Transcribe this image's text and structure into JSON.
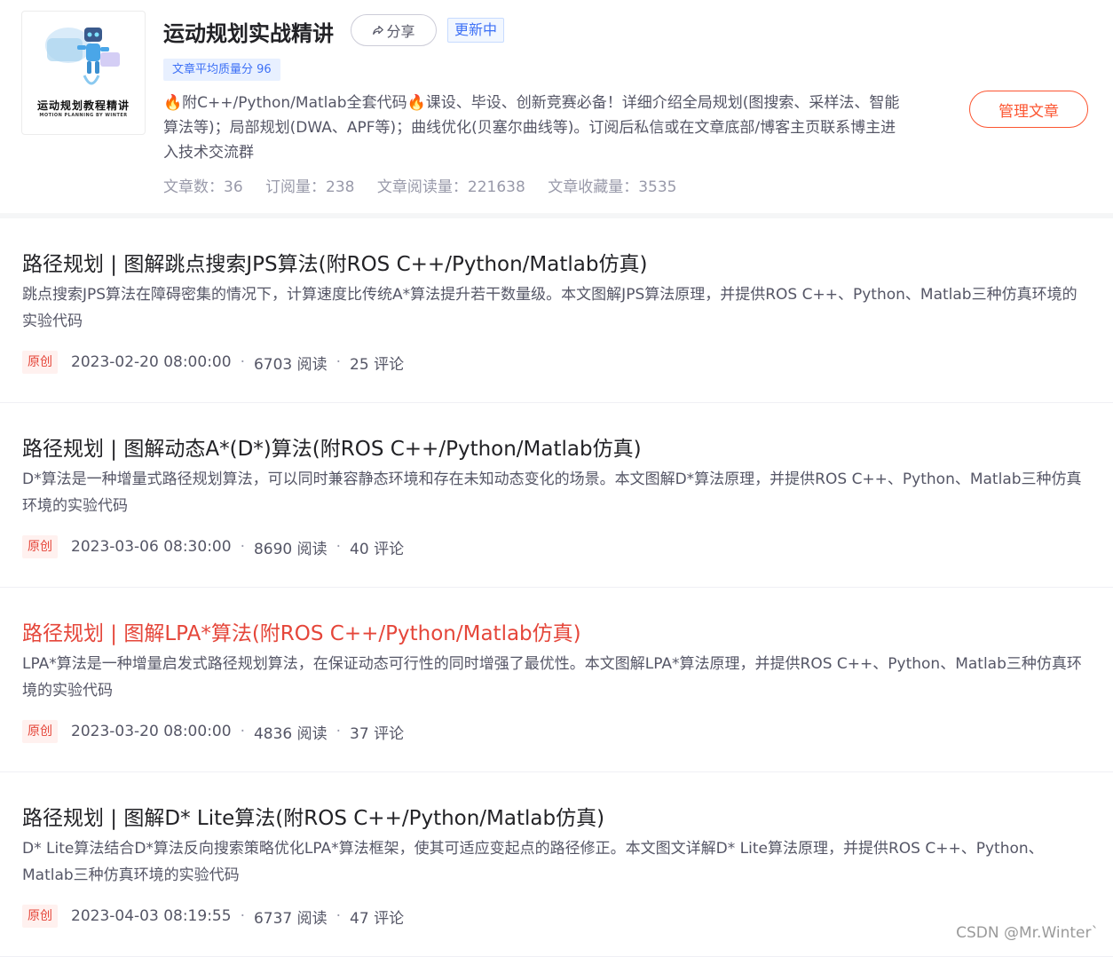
{
  "column": {
    "cover_title": "运动规划教程精讲",
    "cover_subtitle": "MOTION PLANNING BY WINTER",
    "title": "运动规划实战精讲",
    "share_label": "分享",
    "status_badge": "更新中",
    "quality_badge": "文章平均质量分 96",
    "description": "🔥附C++/Python/Matlab全套代码🔥课设、毕设、创新竞赛必备！详细介绍全局规划(图搜索、采样法、智能算法等)；局部规划(DWA、APF等)；曲线优化(贝塞尔曲线等)。订阅后私信或在文章底部/博客主页联系博主进入技术交流群",
    "manage_label": "管理文章",
    "stats": {
      "articles": "文章数：36",
      "subscriptions": "订阅量：238",
      "reads": "文章阅读量：221638",
      "favorites": "文章收藏量：3535"
    }
  },
  "articles": [
    {
      "title": "路径规划 | 图解跳点搜索JPS算法(附ROS C++/Python/Matlab仿真)",
      "description": "跳点搜索JPS算法在障碍密集的情况下，计算速度比传统A*算法提升若干数量级。本文图解JPS算法原理，并提供ROS C++、Python、Matlab三种仿真环境的实验代码",
      "badge": "原创",
      "date": "2023-02-20 08:00:00",
      "reads": "6703 阅读",
      "comments": "25 评论"
    },
    {
      "title": "路径规划 | 图解动态A*(D*)算法(附ROS C++/Python/Matlab仿真)",
      "description": "D*算法是一种增量式路径规划算法，可以同时兼容静态环境和存在未知动态变化的场景。本文图解D*算法原理，并提供ROS C++、Python、Matlab三种仿真环境的实验代码",
      "badge": "原创",
      "date": "2023-03-06 08:30:00",
      "reads": "8690 阅读",
      "comments": "40 评论"
    },
    {
      "title": "路径规划 | 图解LPA*算法(附ROS C++/Python/Matlab仿真)",
      "description": "LPA*算法是一种增量启发式路径规划算法，在保证动态可行性的同时增强了最优性。本文图解LPA*算法原理，并提供ROS C++、Python、Matlab三种仿真环境的实验代码",
      "badge": "原创",
      "date": "2023-03-20 08:00:00",
      "reads": "4836 阅读",
      "comments": "37 评论"
    },
    {
      "title": "路径规划 | 图解D* Lite算法(附ROS C++/Python/Matlab仿真)",
      "description": "D* Lite算法结合D*算法反向搜索策略优化LPA*算法框架，使其可适应变起点的路径修正。本文图文详解D* Lite算法原理，并提供ROS C++、Python、Matlab三种仿真环境的实验代码",
      "badge": "原创",
      "date": "2023-04-03 08:19:55",
      "reads": "6737 阅读",
      "comments": "47 评论"
    }
  ],
  "separator": "·",
  "watermark": "CSDN @Mr.Winter`",
  "colors": {
    "accent": "#fc5531",
    "hover_title": "#e5463a",
    "blue": "#3e71f6"
  },
  "icons": {
    "share": "share-arrow-icon",
    "cover": "robot-illustration"
  }
}
